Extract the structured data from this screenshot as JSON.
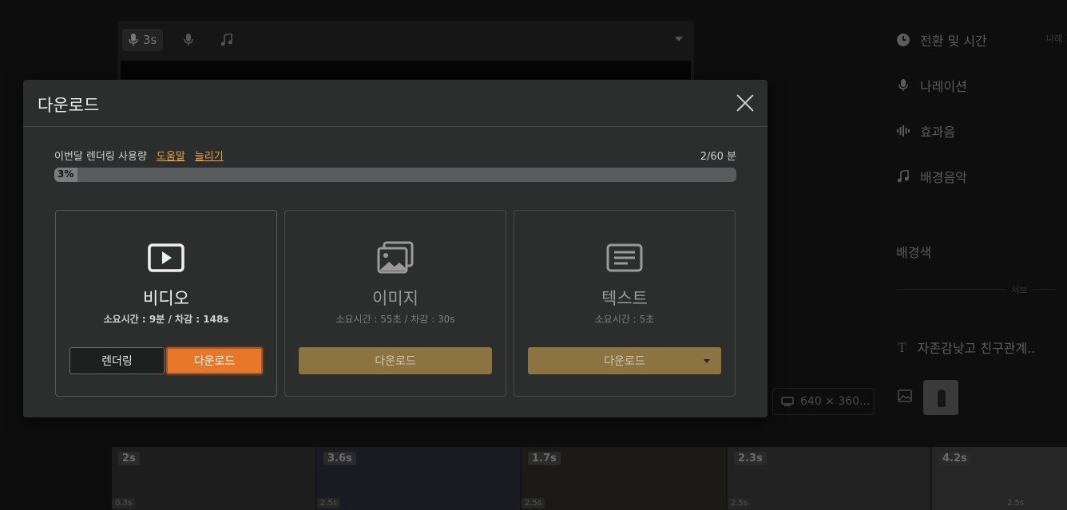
{
  "background": {
    "editor_tabs": [
      {
        "label": "3s",
        "icon": "mic-icon",
        "active": true
      },
      {
        "label": "",
        "icon": "mic-icon",
        "active": false
      },
      {
        "label": "",
        "icon": "music-note-icon",
        "active": false
      }
    ],
    "side_panel": {
      "items": [
        {
          "label": "전환 및 시간",
          "icon": "clock-icon"
        },
        {
          "label": "나레이션",
          "icon": "mic-icon"
        },
        {
          "label": "효과음",
          "icon": "sound-wave-icon"
        },
        {
          "label": "배경음악",
          "icon": "music-note-icon"
        }
      ],
      "extra_label": "나레",
      "bg_color_label": "배경색",
      "divider_label": "서브",
      "text_item": "자존감낮고 친구관계..",
      "text_icon": "T"
    },
    "resolution": "640 × 360...",
    "timeline": [
      {
        "duration": "2s",
        "transition": "0.3s"
      },
      {
        "duration": "3.6s",
        "transition": "2.5s"
      },
      {
        "duration": "1.7s",
        "transition": "2.5s"
      },
      {
        "duration": "2.3s",
        "transition": "2.5s"
      },
      {
        "duration": "4.2s",
        "transition": "2.5s"
      }
    ]
  },
  "modal": {
    "title": "다운로드",
    "usage": {
      "label": "이번달 렌더링 사용량",
      "help_link": "도움말",
      "increase_link": "늘리기",
      "amount": "2/60 분",
      "percent_text": "3%",
      "percent": 3
    },
    "cards": [
      {
        "title": "비디오",
        "subtitle": "소요시간 : 9분 / 차감 : 148s",
        "render_label": "렌더링",
        "download_label": "다운로드"
      },
      {
        "title": "이미지",
        "subtitle": "소요시간 : 55초 / 차감 : 30s",
        "download_label": "다운로드"
      },
      {
        "title": "텍스트",
        "subtitle": "소요시간 : 5초",
        "download_label": "다운로드"
      }
    ]
  },
  "colors": {
    "accent_orange": "#e9772a",
    "link_gold": "#e8a33a",
    "button_gold": "#8c7342",
    "modal_bg": "#2c2d2d"
  }
}
